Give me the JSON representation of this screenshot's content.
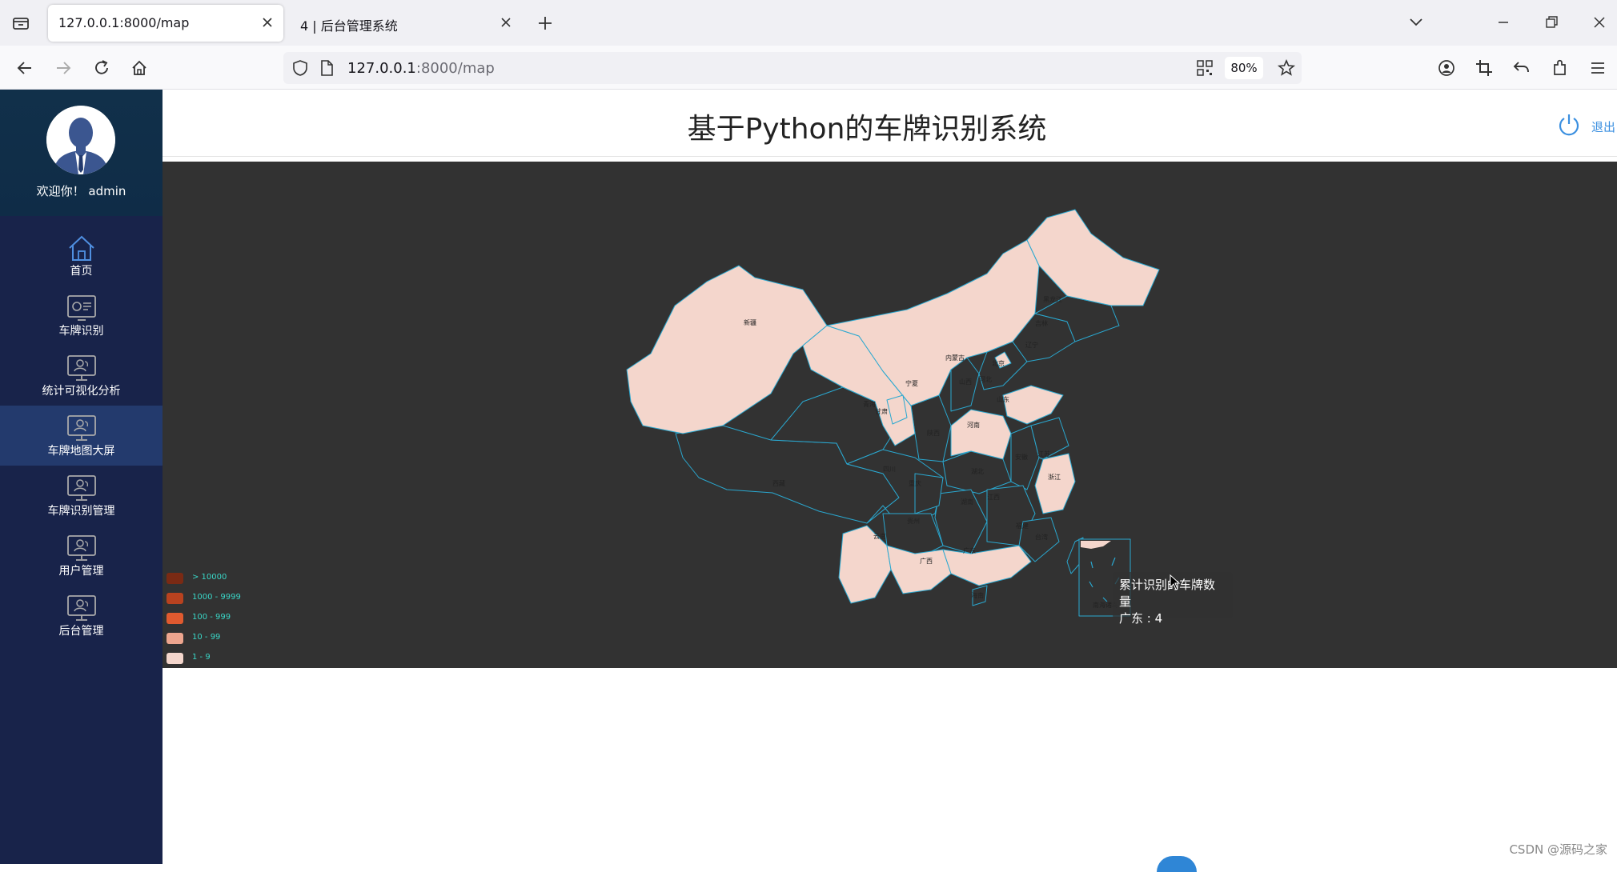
{
  "browser": {
    "tabs": [
      {
        "title": "127.0.0.1:8000/map",
        "active": true
      },
      {
        "title": "4 | 后台管理系统",
        "active": false
      }
    ],
    "url_host": "127.0.0.1",
    "url_rest": ":8000/map",
    "zoom": "80%"
  },
  "app": {
    "title": "基于Python的车牌识别系统",
    "logout_label": "退出",
    "welcome": "欢迎你！ admin"
  },
  "sidebar": {
    "items": [
      {
        "label": "首页",
        "icon": "home-icon"
      },
      {
        "label": "车牌识别",
        "icon": "dashboard-icon"
      },
      {
        "label": "统计可视化分析",
        "icon": "monitor-user-icon"
      },
      {
        "label": "车牌地图大屏",
        "icon": "monitor-user-icon",
        "active": true
      },
      {
        "label": "车牌识别管理",
        "icon": "monitor-user-icon"
      },
      {
        "label": "用户管理",
        "icon": "monitor-user-icon"
      },
      {
        "label": "后台管理",
        "icon": "monitor-user-icon"
      }
    ]
  },
  "map": {
    "legend": [
      {
        "label": "> 10000",
        "color": "#7a2a14"
      },
      {
        "label": "1000 - 9999",
        "color": "#b8421f"
      },
      {
        "label": "100 - 999",
        "color": "#e05a2f"
      },
      {
        "label": "10 - 99",
        "color": "#eda58e"
      },
      {
        "label": "1 - 9",
        "color": "#f4d6cc"
      }
    ],
    "province_labels": [
      "新疆",
      "西藏",
      "青海",
      "甘肃",
      "内蒙古",
      "黑龙江",
      "吉林",
      "辽宁",
      "北京",
      "河北",
      "山西",
      "山东",
      "河南",
      "陕西",
      "宁夏",
      "四川",
      "重庆",
      "湖北",
      "安徽",
      "江苏",
      "浙江",
      "江西",
      "湖南",
      "贵州",
      "云南",
      "广西",
      "广东",
      "福建",
      "台湾",
      "海南",
      "南海诸岛"
    ],
    "tooltip_title": "累计识别的车牌数量",
    "tooltip_value": "广东 : 4",
    "data": [
      {
        "province": "广东",
        "value": 4
      }
    ]
  },
  "watermark": "CSDN @源码之家"
}
